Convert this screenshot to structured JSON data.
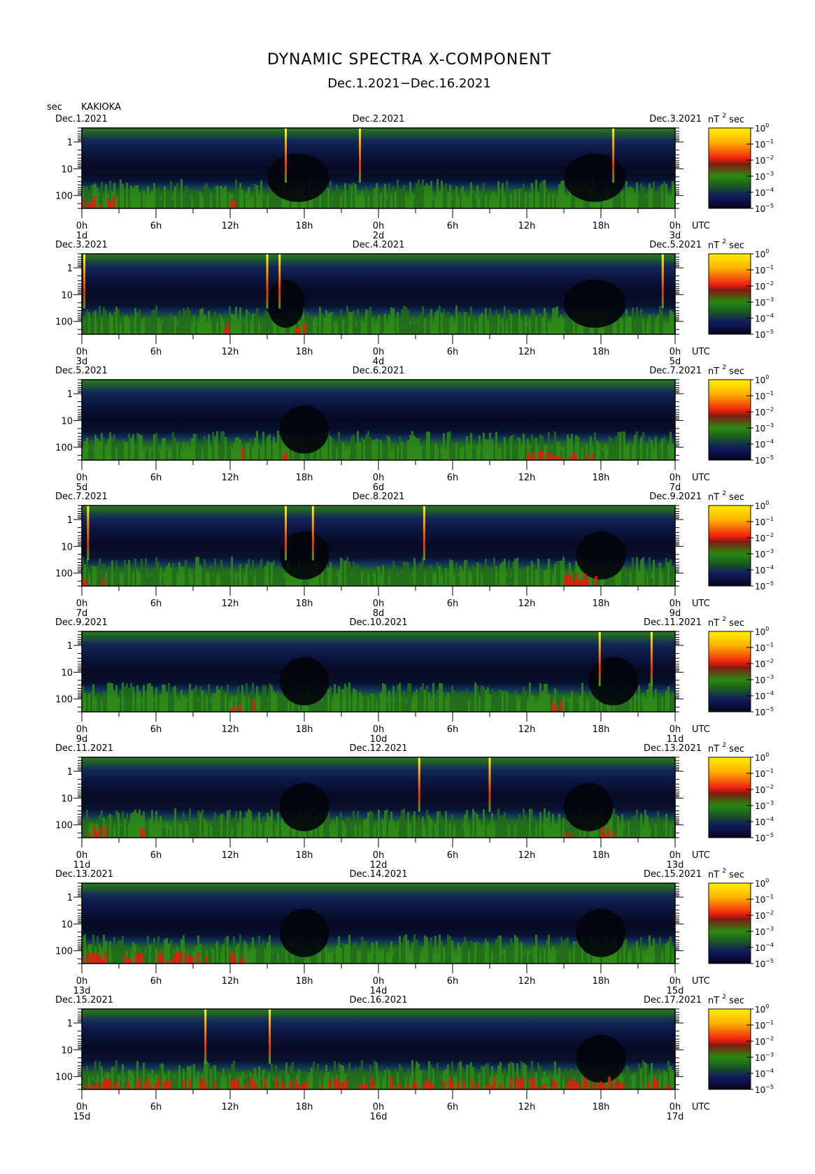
{
  "title": "DYNAMIC SPECTRA X-COMPONENT",
  "subtitle": "Dec.1.2021−Dec.16.2021",
  "y_unit": "sec",
  "station": "KAKIOKA",
  "time_axis_label": "UTC",
  "colorbar_unit_label": "nT",
  "colorbar_unit_exp": "2",
  "colorbar_unit_suffix": "sec",
  "colorbar_base": "10",
  "colorbar_exponents": [
    "0",
    "−1",
    "−2",
    "−3",
    "−4",
    "−5"
  ],
  "y_tick_labels": [
    "1",
    "10",
    "100"
  ],
  "x_tick_labels": [
    "0h",
    "6h",
    "12h",
    "18h",
    "0h",
    "6h",
    "12h",
    "18h",
    "0h"
  ],
  "chart_data": [
    {
      "type": "heatmap",
      "start_label": "Dec.1.2021",
      "mid_label": "Dec.2.2021",
      "end_label": "Dec.3.2021",
      "day_labels": [
        "1d",
        "2d",
        "3d"
      ],
      "spikes_hours": [
        16.5,
        22.5,
        43.0
      ],
      "quiet_zones_hours": [
        [
          15,
          20
        ],
        [
          39,
          44
        ]
      ],
      "red_regions_hours": [
        [
          0,
          3
        ],
        [
          12,
          13
        ]
      ],
      "ylim_sec": [
        0.3,
        300
      ],
      "colorbar_range": [
        1e-05,
        1
      ]
    },
    {
      "type": "heatmap",
      "start_label": "Dec.3.2021",
      "mid_label": "Dec.4.2021",
      "end_label": "Dec.5.2021",
      "day_labels": [
        "3d",
        "4d",
        "5d"
      ],
      "spikes_hours": [
        0.2,
        15.0,
        16.0,
        47.0
      ],
      "quiet_zones_hours": [
        [
          15,
          18
        ],
        [
          39,
          44
        ]
      ],
      "red_regions_hours": [
        [
          11,
          12
        ],
        [
          17,
          18
        ]
      ],
      "ylim_sec": [
        0.3,
        300
      ],
      "colorbar_range": [
        1e-05,
        1
      ]
    },
    {
      "type": "heatmap",
      "start_label": "Dec.5.2021",
      "mid_label": "Dec.6.2021",
      "end_label": "Dec.7.2021",
      "day_labels": [
        "5d",
        "6d",
        "7d"
      ],
      "spikes_hours": [],
      "quiet_zones_hours": [
        [
          16,
          20
        ]
      ],
      "red_regions_hours": [
        [
          12,
          13
        ],
        [
          16,
          17
        ],
        [
          36,
          42
        ]
      ],
      "ylim_sec": [
        0.3,
        300
      ],
      "colorbar_range": [
        1e-05,
        1
      ]
    },
    {
      "type": "heatmap",
      "start_label": "Dec.7.2021",
      "mid_label": "Dec.8.2021",
      "end_label": "Dec.9.2021",
      "day_labels": [
        "7d",
        "8d",
        "9d"
      ],
      "spikes_hours": [
        0.5,
        16.5,
        18.7,
        27.7
      ],
      "quiet_zones_hours": [
        [
          16,
          20
        ],
        [
          40,
          44
        ]
      ],
      "red_regions_hours": [
        [
          0,
          2
        ],
        [
          39,
          42
        ]
      ],
      "ylim_sec": [
        0.3,
        300
      ],
      "colorbar_range": [
        1e-05,
        1
      ]
    },
    {
      "type": "heatmap",
      "start_label": "Dec.9.2021",
      "mid_label": "Dec.10.2021",
      "end_label": "Dec.11.2021",
      "day_labels": [
        "9d",
        "10d",
        "11d"
      ],
      "spikes_hours": [
        41.9,
        46.1
      ],
      "quiet_zones_hours": [
        [
          16,
          20
        ],
        [
          41,
          45
        ]
      ],
      "red_regions_hours": [
        [
          12,
          14
        ],
        [
          38,
          39
        ]
      ],
      "ylim_sec": [
        0.3,
        300
      ],
      "colorbar_range": [
        1e-05,
        1
      ]
    },
    {
      "type": "heatmap",
      "start_label": "Dec.11.2021",
      "mid_label": "Dec.12.2021",
      "end_label": "Dec.13.2021",
      "day_labels": [
        "11d",
        "12d",
        "13d"
      ],
      "spikes_hours": [
        27.3,
        33.0
      ],
      "quiet_zones_hours": [
        [
          16,
          20
        ],
        [
          39,
          43
        ]
      ],
      "red_regions_hours": [
        [
          0,
          2
        ],
        [
          4,
          5
        ],
        [
          39,
          40
        ],
        [
          42,
          43
        ]
      ],
      "ylim_sec": [
        0.3,
        300
      ],
      "colorbar_range": [
        1e-05,
        1
      ]
    },
    {
      "type": "heatmap",
      "start_label": "Dec.13.2021",
      "mid_label": "Dec.14.2021",
      "end_label": "Dec.15.2021",
      "day_labels": [
        "13d",
        "14d",
        "15d"
      ],
      "spikes_hours": [],
      "quiet_zones_hours": [
        [
          16,
          20
        ],
        [
          40,
          44
        ]
      ],
      "red_regions_hours": [
        [
          0,
          10
        ],
        [
          12,
          13
        ]
      ],
      "ylim_sec": [
        0.3,
        300
      ],
      "colorbar_range": [
        1e-05,
        1
      ]
    },
    {
      "type": "heatmap",
      "start_label": "Dec.15.2021",
      "mid_label": "Dec.16.2021",
      "end_label": "Dec.17.2021",
      "day_labels": [
        "15d",
        "16d",
        "17d"
      ],
      "spikes_hours": [
        10.0,
        15.2
      ],
      "quiet_zones_hours": [
        [
          40,
          44
        ]
      ],
      "red_regions_hours": [
        [
          0,
          48
        ]
      ],
      "ylim_sec": [
        0.3,
        300
      ],
      "colorbar_range": [
        1e-05,
        1
      ]
    }
  ],
  "colors": {
    "low": "#0a0a1e",
    "mid_blue": "#1a2a70",
    "green": "#2f8a1a",
    "red": "#e02010",
    "yellow": "#ffee00"
  }
}
